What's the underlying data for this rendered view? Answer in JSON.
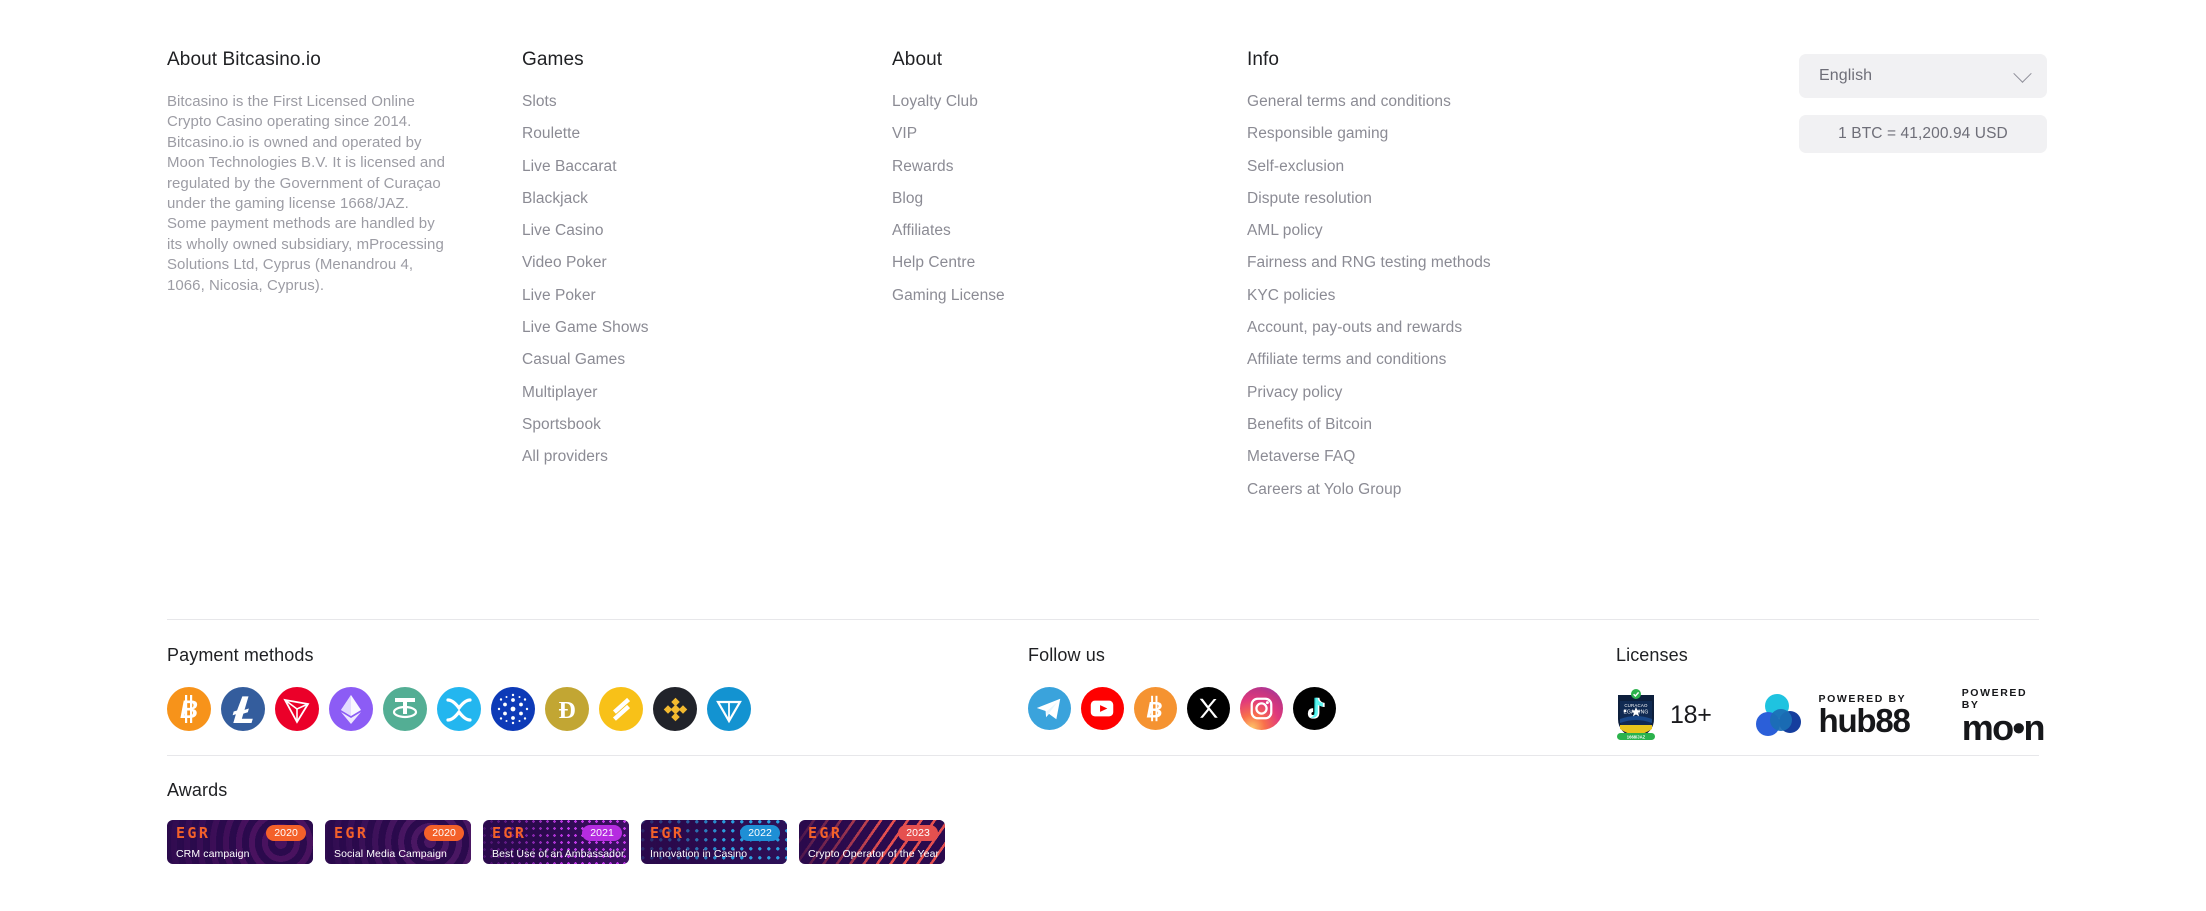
{
  "columns": {
    "about_text": {
      "heading": "About Bitcasino.io",
      "paragraph": "Bitcasino is the First Licensed Online Crypto Casino operating since 2014. Bitcasino.io is owned and operated by Moon Technologies B.V. It is licensed and regulated by the Government of Curaçao under the gaming license 1668/JAZ. Some payment methods are handled by its wholly owned subsidiary, mProcessing Solutions Ltd, Cyprus (Menandrou 4, 1066, Nicosia, Cyprus)."
    },
    "games": {
      "heading": "Games",
      "links": [
        "Slots",
        "Roulette",
        "Live Baccarat",
        "Blackjack",
        "Live Casino",
        "Video Poker",
        "Live Poker",
        "Live Game Shows",
        "Casual Games",
        "Multiplayer",
        "Sportsbook",
        "All providers"
      ]
    },
    "about": {
      "heading": "About",
      "links": [
        "Loyalty Club",
        "VIP",
        "Rewards",
        "Blog",
        "Affiliates",
        "Help Centre",
        "Gaming License"
      ]
    },
    "info": {
      "heading": "Info",
      "links": [
        "General terms and conditions",
        "Responsible gaming",
        "Self-exclusion",
        "Dispute resolution",
        "AML policy",
        "Fairness and RNG testing methods",
        "KYC policies",
        "Account, pay-outs and rewards",
        "Affiliate terms and conditions",
        "Privacy policy",
        "Benefits of Bitcoin",
        "Metaverse FAQ",
        "Careers at Yolo Group"
      ]
    }
  },
  "language_selector": {
    "selected": "English",
    "icon": "chevron-down-icon",
    "options": [
      "English"
    ]
  },
  "exchange_rate": {
    "text": "1 BTC = 41,200.94 USD"
  },
  "payment_methods": {
    "heading": "Payment methods",
    "items": [
      {
        "name": "bitcoin-icon",
        "label": "Bitcoin",
        "bg": "#f7931a",
        "glyph": "₿"
      },
      {
        "name": "litecoin-icon",
        "label": "Litecoin",
        "bg": "#345d9d",
        "glyph": "Ł"
      },
      {
        "name": "tron-icon",
        "label": "Tron",
        "bg": "#eb0029",
        "glyph": "TRX"
      },
      {
        "name": "ethereum-icon",
        "label": "Ethereum",
        "bg": "#8c5cf5",
        "glyph": "ETH"
      },
      {
        "name": "tether-icon",
        "label": "Tether",
        "bg": "#53ae94",
        "glyph": "₮"
      },
      {
        "name": "ripple-icon",
        "label": "XRP",
        "bg": "#23b6ef",
        "glyph": "XRP"
      },
      {
        "name": "cardano-icon",
        "label": "Cardano",
        "bg": "#0d3ab7",
        "glyph": "ADA"
      },
      {
        "name": "dogecoin-icon",
        "label": "Dogecoin",
        "bg": "#c2a633",
        "glyph": "Ð"
      },
      {
        "name": "binance-usd-icon",
        "label": "Binance USD",
        "bg": "#f8c118",
        "glyph": "BUSD"
      },
      {
        "name": "binance-coin-icon",
        "label": "Binance Coin",
        "bg": "#21232a",
        "glyph": "BNB"
      },
      {
        "name": "toncoin-icon",
        "label": "Toncoin",
        "bg": "#1393d1",
        "glyph": "TON"
      }
    ]
  },
  "follow_us": {
    "heading": "Follow us",
    "items": [
      {
        "name": "telegram-icon",
        "label": "Telegram",
        "bg": "#3aa3dc"
      },
      {
        "name": "youtube-icon",
        "label": "YouTube",
        "bg": "#ff0000"
      },
      {
        "name": "bitcointalk-icon",
        "label": "Bitcointalk",
        "bg": "#f59331"
      },
      {
        "name": "x-twitter-icon",
        "label": "X",
        "bg": "#000000"
      },
      {
        "name": "instagram-icon",
        "label": "Instagram",
        "bg": "#e0397c"
      },
      {
        "name": "tiktok-icon",
        "label": "TikTok",
        "bg": "#010101"
      }
    ]
  },
  "licenses": {
    "heading": "Licenses",
    "curacao_badge": {
      "name": "curacao-egaming-shield-icon",
      "top_text": "CURACAO",
      "mid_text": "EGAMING",
      "bottom_text": "1668/JAZ"
    },
    "age_badge": "18+",
    "hub88": {
      "powered_by": "POWERED BY",
      "word": "hub88"
    },
    "moon": {
      "powered_by": "POWERED BY",
      "word": "mo•n"
    }
  },
  "awards": {
    "heading": "Awards",
    "items": [
      {
        "brand": "EGR",
        "year": "2020",
        "title": "CRM campaign",
        "year_bg": "#f4612a",
        "bg": "#2b0a4d",
        "pattern": "rings-orange"
      },
      {
        "brand": "EGR",
        "year": "2020",
        "title": "Social Media Campaign",
        "year_bg": "#f4612a",
        "bg": "#2b0a4d",
        "pattern": "rings-purple"
      },
      {
        "brand": "EGR",
        "year": "2021",
        "title": "Best Use of an Ambassador",
        "year_bg": "#b52ce0",
        "bg": "#2b0a4d",
        "pattern": "dots-magenta"
      },
      {
        "brand": "EGR",
        "year": "2022",
        "title": "Innovation in Casino",
        "year_bg": "#1e8fd5",
        "bg": "#2b0a4d",
        "pattern": "dots-blue"
      },
      {
        "brand": "EGR",
        "year": "2023",
        "title": "Crypto Operator of the Year",
        "year_bg": "#e5504f",
        "bg": "#2b0a4d",
        "pattern": "stripes-red"
      }
    ]
  },
  "theme": {
    "background": "#ffffff",
    "heading_color": "#1f2023",
    "link_color": "#8b8b94",
    "muted_text": "#9c9ca4",
    "divider": "#e7e7ea",
    "chip_bg": "#f1f1f3"
  }
}
